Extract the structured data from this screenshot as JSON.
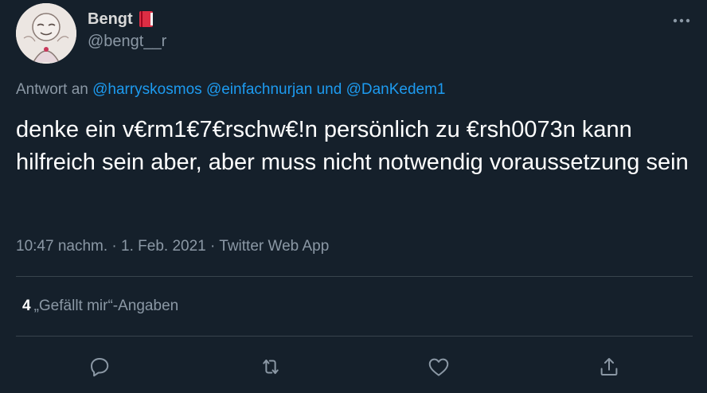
{
  "author": {
    "display_name": "Bengt",
    "handle": "@bengt__r",
    "badge_icon": "closed-book-icon"
  },
  "reply": {
    "prefix": "Antwort an",
    "mentions": [
      "@harryskosmos",
      "@einfachnurjan"
    ],
    "conjunction": "und",
    "last_mention": "@DanKedem1"
  },
  "tweet": {
    "text": "denke ein v€rm1€7€rschw€!n persönlich zu €rsh0073n kann hilfreich sein aber, aber muss nicht notwendig voraussetzung sein"
  },
  "meta": {
    "time": "10:47 nachm.",
    "separator": "·",
    "date": "1. Feb. 2021",
    "source": "Twitter Web App"
  },
  "stats": {
    "likes_count": "4",
    "likes_label": "„Gefällt mir“-Angaben"
  },
  "actions": [
    "reply-icon",
    "retweet-icon",
    "like-icon",
    "share-icon"
  ],
  "colors": {
    "background": "#15202b",
    "link": "#1d9bf0",
    "secondary_text": "#8b98a5",
    "primary_text": "#ffffff",
    "divider": "#38444d"
  }
}
